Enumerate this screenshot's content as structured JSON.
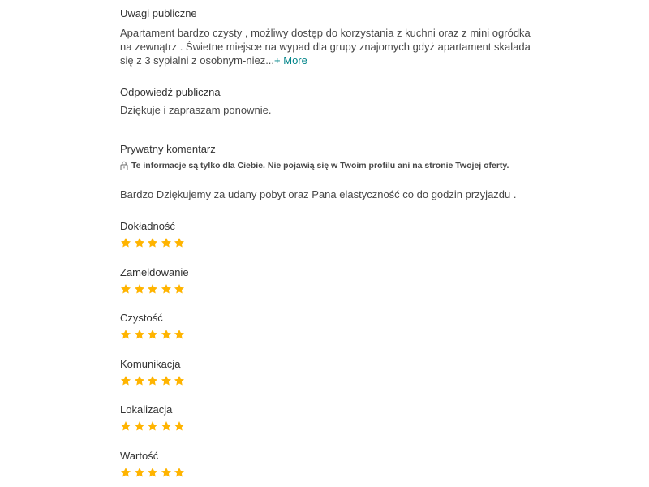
{
  "public_review": {
    "title": "Uwagi publiczne",
    "text": "Apartament bardzo czysty , możliwy dostęp do korzystania z kuchni oraz z mini ogródka na zewnątrz . Świetne miejsce na wypad dla grupy znajomych gdyż apartament skalada się z 3 sypialni z osobnym-niez...",
    "more_label": "+ More"
  },
  "public_response": {
    "title": "Odpowiedź publiczna",
    "text": "Dziękuje i zapraszam ponownie."
  },
  "private_comment": {
    "title": "Prywatny komentarz",
    "note": "Te informacje są tylko dla Ciebie. Nie pojawią się w Twoim profilu ani na stronie Twojej oferty.",
    "text": "Bardzo Dziękujemy za udany pobyt oraz Pana elastyczność co do godzin przyjazdu ."
  },
  "ratings": [
    {
      "label": "Dokładność",
      "stars": 5,
      "max": 5
    },
    {
      "label": "Zameldowanie",
      "stars": 5,
      "max": 5
    },
    {
      "label": "Czystość",
      "stars": 5,
      "max": 5
    },
    {
      "label": "Komunikacja",
      "stars": 5,
      "max": 5
    },
    {
      "label": "Lokalizacja",
      "stars": 5,
      "max": 5
    },
    {
      "label": "Wartość",
      "stars": 5,
      "max": 5
    }
  ],
  "colors": {
    "star": "#FFB400",
    "link": "#008489",
    "divider": "#E4E4E4"
  },
  "icons": {
    "lock": "lock-icon",
    "star": "star-icon"
  }
}
